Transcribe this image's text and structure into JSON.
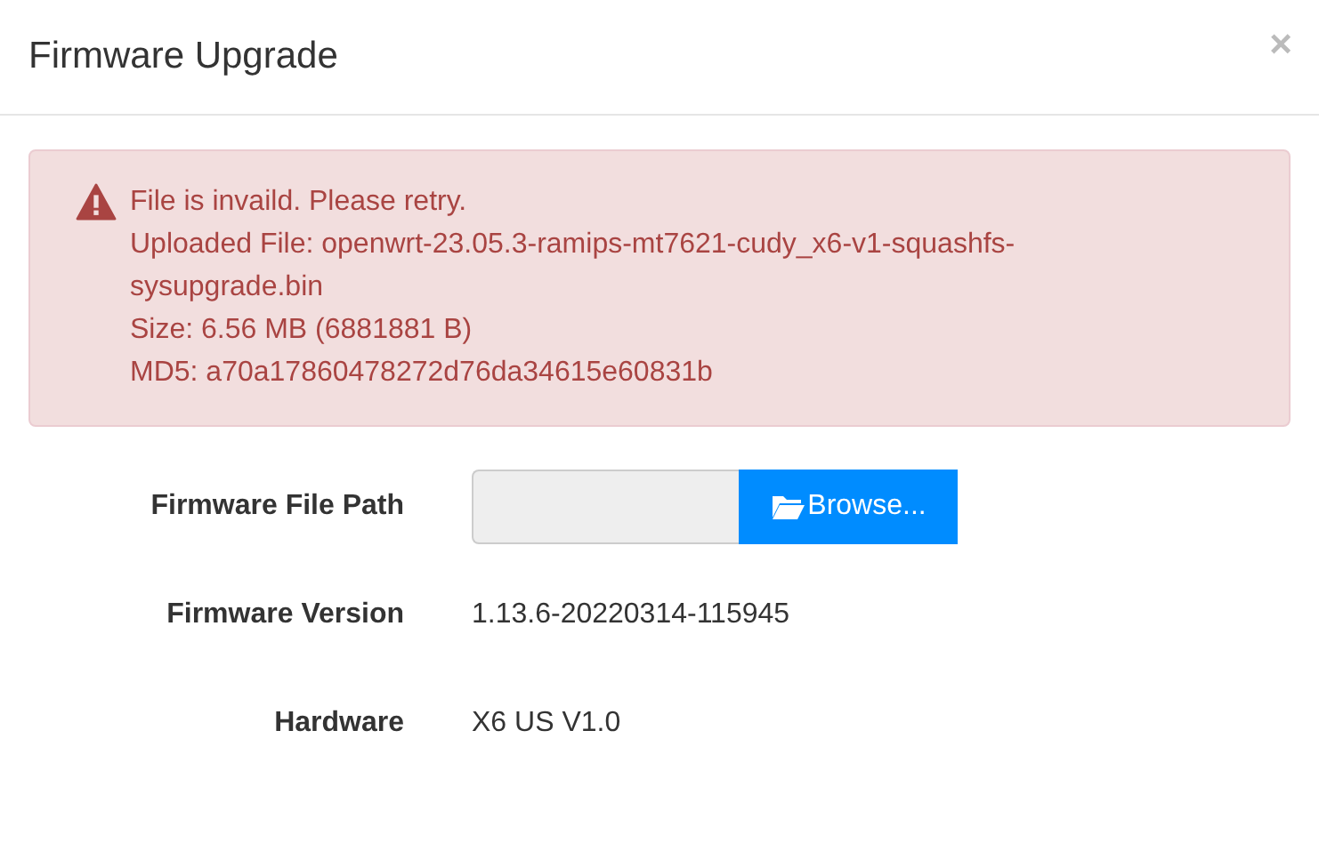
{
  "dialog": {
    "title": "Firmware Upgrade",
    "close": "×"
  },
  "alert": {
    "lines": [
      "File is invaild. Please retry.",
      "Uploaded File: openwrt-23.05.3-ramips-mt7621-cudy_x6-v1-squashfs-sysupgrade.bin",
      "Size: 6.56 MB (6881881 B)",
      "MD5: a70a17860478272d76da34615e60831b"
    ]
  },
  "fields": [
    {
      "kind": "file",
      "label": "Firmware File Path",
      "button": "Browse..."
    },
    {
      "kind": "text",
      "label": "Firmware Version",
      "value": "1.13.6-20220314-115945"
    },
    {
      "kind": "text",
      "label": "Hardware",
      "value": "X6 US V1.0"
    }
  ]
}
